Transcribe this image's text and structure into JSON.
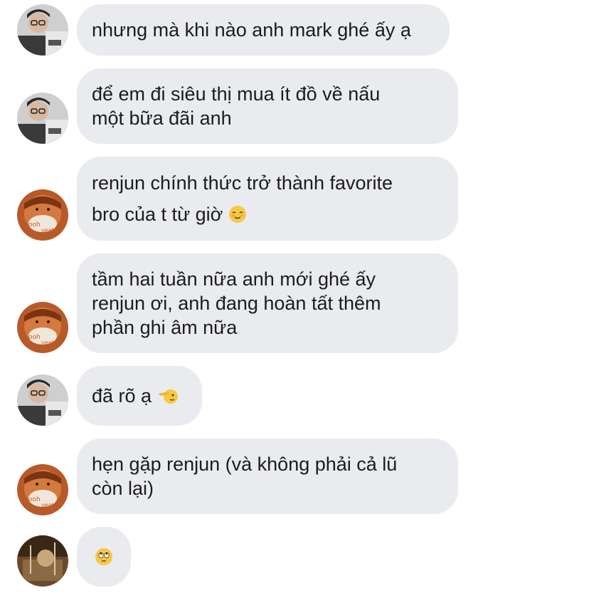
{
  "messages": [
    {
      "sender": "mark",
      "lines": [
        "nhưng mà khi nào anh mark ghé ấy ạ"
      ]
    },
    {
      "sender": "mark",
      "lines": [
        "để em đi siêu thị mua ít đồ về nấu",
        "một bữa đãi anh"
      ]
    },
    {
      "sender": "renjun",
      "lines": [
        "renjun chính thức trở thành favorite",
        "bro của t từ giờ"
      ],
      "emoji": "smiling-blush-emoji"
    },
    {
      "sender": "renjun",
      "lines": [
        "tầm hai tuần nữa anh mới ghé ấy",
        "renjun ơi, anh đang hoàn tất thêm",
        "phần ghi âm nữa"
      ]
    },
    {
      "sender": "mark",
      "lines": [
        "đã rõ ạ"
      ],
      "emoji": "salute-emoji"
    },
    {
      "sender": "renjun",
      "lines": [
        "hẹn gặp renjun (và không phải cả lũ",
        "còn lại)"
      ]
    },
    {
      "sender": "third",
      "lines": [
        ""
      ],
      "emoji": "eye-roll-emoji"
    }
  ],
  "colors": {
    "bubble_bg": "#e9ebef",
    "text": "#1c1c1e",
    "background": "#ffffff"
  }
}
